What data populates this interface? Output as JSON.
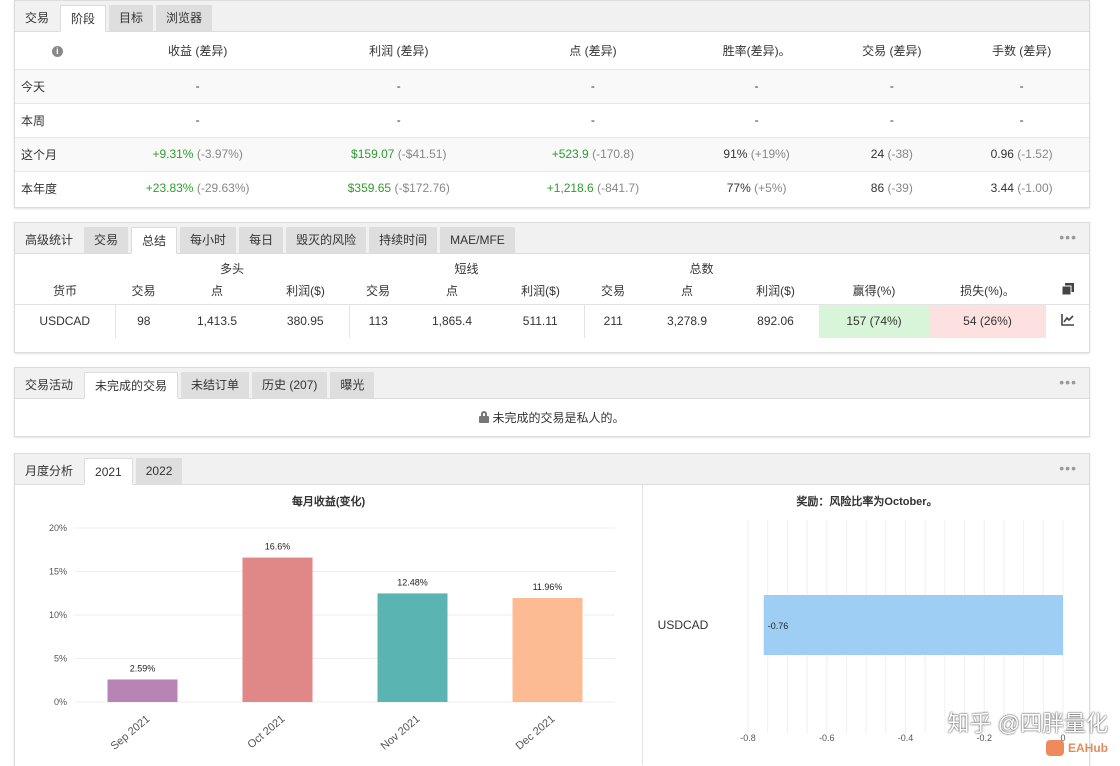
{
  "period_panel": {
    "tabs": [
      "交易",
      "阶段",
      "目标",
      "浏览器"
    ],
    "active_tab": 1,
    "columns": [
      "收益 (差异)",
      "利润 (差异)",
      "点 (差异)",
      "胜率(差异)。",
      "交易 (差异)",
      "手数 (差异)"
    ],
    "rows": [
      {
        "label": "今天",
        "cells": [
          {
            "v": "-",
            "d": ""
          },
          {
            "v": "-",
            "d": ""
          },
          {
            "v": "-",
            "d": ""
          },
          {
            "v": "-",
            "d": ""
          },
          {
            "v": "-",
            "d": ""
          },
          {
            "v": "-",
            "d": ""
          }
        ]
      },
      {
        "label": "本周",
        "cells": [
          {
            "v": "-",
            "d": ""
          },
          {
            "v": "-",
            "d": ""
          },
          {
            "v": "-",
            "d": ""
          },
          {
            "v": "-",
            "d": ""
          },
          {
            "v": "-",
            "d": ""
          },
          {
            "v": "-",
            "d": ""
          }
        ]
      },
      {
        "label": "这个月",
        "cells": [
          {
            "v": "+9.31%",
            "d": "(-3.97%)"
          },
          {
            "v": "$159.07",
            "d": "(-$41.51)"
          },
          {
            "v": "+523.9",
            "d": "(-170.8)"
          },
          {
            "v": "91%",
            "d": "(+19%)"
          },
          {
            "v": "24",
            "d": "(-38)"
          },
          {
            "v": "0.96",
            "d": "(-1.52)"
          }
        ]
      },
      {
        "label": "本年度",
        "cells": [
          {
            "v": "+23.83%",
            "d": "(-29.63%)"
          },
          {
            "v": "$359.65",
            "d": "(-$172.76)"
          },
          {
            "v": "+1,218.6",
            "d": "(-841.7)"
          },
          {
            "v": "77%",
            "d": "(+5%)"
          },
          {
            "v": "86",
            "d": "(-39)"
          },
          {
            "v": "3.44",
            "d": "(-1.00)"
          }
        ]
      }
    ]
  },
  "stats_panel": {
    "tabs": [
      "高级统计",
      "交易",
      "总结",
      "每小时",
      "每日",
      "毁灭的风险",
      "持续时间",
      "MAE/MFE"
    ],
    "active_tab": 2,
    "groups": {
      "long": "多头",
      "short": "短线",
      "total": "总数"
    },
    "headers": {
      "currency": "货币",
      "long": [
        "交易",
        "点",
        "利润($)"
      ],
      "short": [
        "交易",
        "点",
        "利润($)"
      ],
      "total": [
        "交易",
        "点",
        "利润($)"
      ],
      "won": "赢得(%)",
      "lost": "损失(%)。"
    },
    "row": {
      "currency": "USDCAD",
      "long": [
        "98",
        "1,413.5",
        "380.95"
      ],
      "short": [
        "113",
        "1,865.4",
        "511.11"
      ],
      "total": [
        "211",
        "3,278.9",
        "892.06"
      ],
      "won": "157 (74%)",
      "lost": "54 (26%)"
    }
  },
  "activity_panel": {
    "tabs": [
      "交易活动",
      "未完成的交易",
      "未结订单",
      "历史 (207)",
      "曝光"
    ],
    "active_tab": 1,
    "message": "未完成的交易是私人的。"
  },
  "monthly_panel": {
    "tabs": [
      "月度分析",
      "2021",
      "2022"
    ],
    "active_tab": 1
  },
  "chart_data": [
    {
      "type": "bar",
      "title": "每月收益(变化)",
      "categories": [
        "Sep 2021",
        "Oct 2021",
        "Nov 2021",
        "Dec 2021"
      ],
      "values": [
        2.59,
        16.6,
        12.48,
        11.96
      ],
      "value_labels": [
        "2.59%",
        "16.6%",
        "12.48%",
        "11.96%"
      ],
      "colors": [
        "#b784b5",
        "#e08787",
        "#5ab4b1",
        "#fdbb94"
      ],
      "yticks": [
        "20%",
        "15%",
        "10%",
        "5%",
        "0%"
      ],
      "ylim": [
        0,
        20
      ],
      "grid": true
    },
    {
      "type": "bar",
      "orientation": "horizontal",
      "title": "奖励：风险比率为October。",
      "categories": [
        "USDCAD"
      ],
      "values": [
        -0.76
      ],
      "value_labels": [
        "-0.76"
      ],
      "colors": [
        "#9fcef5"
      ],
      "xticks": [
        "-0.8",
        "-0.6",
        "-0.4",
        "-0.2",
        "0"
      ],
      "xlim": [
        -0.8,
        0
      ],
      "grid": true
    }
  ],
  "watermark": {
    "text": "知乎 @四胖量化",
    "brand": "EAHub"
  }
}
